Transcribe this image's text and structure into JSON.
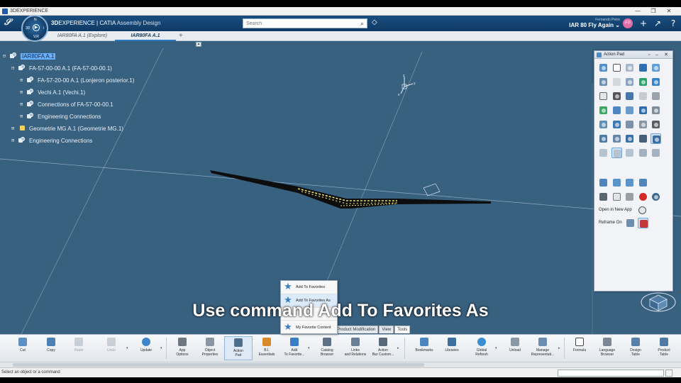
{
  "os_window": {
    "title": "3DEXPERIENCE",
    "controls": [
      "—",
      "❐",
      "✕"
    ]
  },
  "app_header": {
    "brand_bold": "3D",
    "brand_main": "EXPERIENCE | CATIA",
    "brand_app": "Assembly Design",
    "compass_version": "V,R",
    "compass_labels": [
      "3D",
      "N",
      "i",
      "$"
    ],
    "search_placeholder": "Search",
    "user_name": "Fernando Petre",
    "collab_space": "IAR 80 Fly Again",
    "avatar_initials": "FP"
  },
  "tabs": [
    {
      "label": "IAR80FA A.1 (Explore)",
      "active": false
    },
    {
      "label": "IAR80FA A.1",
      "active": true
    }
  ],
  "tree": [
    {
      "label": "IAR80FA A.1",
      "level": 0,
      "selected": true
    },
    {
      "label": "FA-57-00-00 A.1 (FA-57-00-00.1)",
      "level": 1
    },
    {
      "label": "FA-57-20-00 A.1 (Lonjeron posterior.1)",
      "level": 2
    },
    {
      "label": "Vechi A.1 (Vechi.1)",
      "level": 2
    },
    {
      "label": "Connections of FA-57-00-00.1",
      "level": 2
    },
    {
      "label": "Engineering Connections",
      "level": 2
    },
    {
      "label": "Geometrie MG A.1 (Geometrie MG.1)",
      "level": 1
    },
    {
      "label": "Engineering Connections",
      "level": 1
    }
  ],
  "axis_labels": {
    "z": "z",
    "x": "x",
    "y": "y"
  },
  "action_pad": {
    "title": "Action Pad",
    "header_buttons": "▫ – ✕",
    "open_in_new_app": "Open in New App",
    "reframe_on": "Reframe On"
  },
  "favorites_popup": {
    "items": [
      "Add To Favorites",
      "Add To Favorites As",
      "My Favorite Content"
    ]
  },
  "subtitle": "Use command Add To Favorites As",
  "action_bar_tabs": [
    {
      "label": "Product Modification",
      "active": false
    },
    {
      "label": "View",
      "active": false
    },
    {
      "label": "Tools",
      "active": true
    }
  ],
  "action_bar": [
    {
      "label": "Cut",
      "state": "normal"
    },
    {
      "label": "Copy",
      "state": "normal"
    },
    {
      "label": "Paste",
      "state": "disabled"
    },
    {
      "label": "Undo",
      "state": "disabled"
    },
    {
      "label": "Update",
      "state": "normal"
    },
    {
      "label": "App\nOptions",
      "state": "normal"
    },
    {
      "label": "Object\nProperties",
      "state": "normal"
    },
    {
      "label": "Action\nPad",
      "state": "selected"
    },
    {
      "label": "B.I.\nEssentials",
      "state": "normal"
    },
    {
      "label": "Add\nTo Favorite...",
      "state": "normal"
    },
    {
      "label": "Catalog\nBrowser",
      "state": "normal"
    },
    {
      "label": "Links\nand Relations",
      "state": "normal"
    },
    {
      "label": "Action\nBar Custom...",
      "state": "normal"
    },
    {
      "label": "Bookmarks",
      "state": "normal"
    },
    {
      "label": "Libraries",
      "state": "normal"
    },
    {
      "label": "Global\nRefresh",
      "state": "normal"
    },
    {
      "label": "Unload",
      "state": "normal"
    },
    {
      "label": "Manage\nRepresentati...",
      "state": "normal"
    },
    {
      "label": "Formula",
      "state": "normal"
    },
    {
      "label": "Language\nBrowser",
      "state": "normal"
    },
    {
      "label": "Design\nTable",
      "state": "normal"
    },
    {
      "label": "Product\nTable",
      "state": "normal"
    }
  ],
  "status": {
    "message": "Select an object or a command"
  },
  "colors": {
    "viewport_bg": "#38607f",
    "header_bg": "#12426e",
    "selection": "#6ab0ff",
    "wing_accent": "#e8e070"
  }
}
